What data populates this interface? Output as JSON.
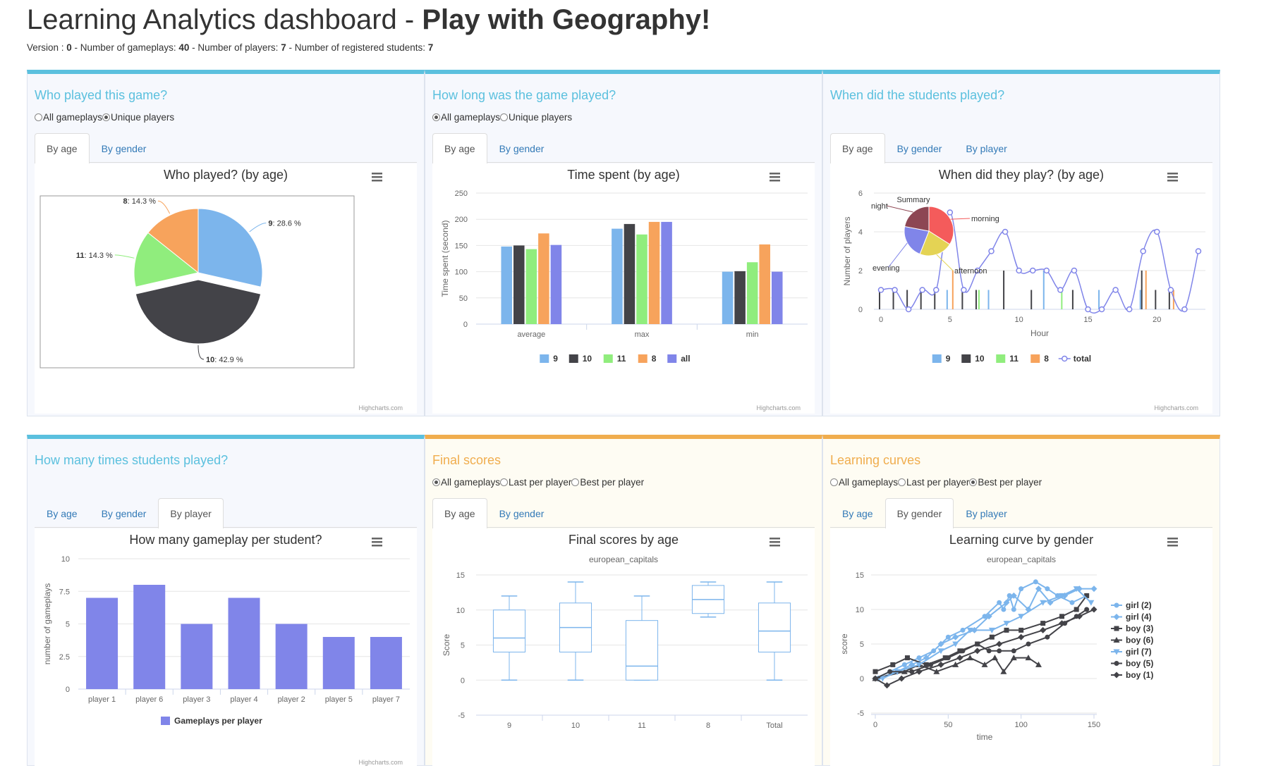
{
  "header": {
    "title": "Learning Analytics dashboard - ",
    "game_name": "Play with Geography!",
    "stats": [
      {
        "label": "Version : ",
        "value": "0"
      },
      {
        "label": " - Number of gameplays: ",
        "value": "40"
      },
      {
        "label": " - Number of players: ",
        "value": "7"
      },
      {
        "label": " - Number of registered students: ",
        "value": "7"
      }
    ]
  },
  "colors": {
    "blue": "#7cb5ec",
    "dark": "#434348",
    "green": "#90ed7d",
    "orange": "#f7a35c",
    "purple": "#8085e9",
    "accent_info": "#5bc0de",
    "accent_warning": "#f0ad4e"
  },
  "panels": {
    "who": {
      "title": "Who played this game?",
      "radios": [
        {
          "label": "All gameplays",
          "checked": false
        },
        {
          "label": "Unique players",
          "checked": true
        }
      ],
      "tabs": [
        {
          "label": "By age",
          "active": true
        },
        {
          "label": "By gender",
          "active": false
        }
      ]
    },
    "time": {
      "title": "How long was the game played?",
      "radios": [
        {
          "label": "All gameplays",
          "checked": true
        },
        {
          "label": "Unique players",
          "checked": false
        }
      ],
      "tabs": [
        {
          "label": "By age",
          "active": true
        },
        {
          "label": "By gender",
          "active": false
        }
      ]
    },
    "when": {
      "title": "When did the students played?",
      "tabs": [
        {
          "label": "By age",
          "active": true
        },
        {
          "label": "By gender",
          "active": false
        },
        {
          "label": "By player",
          "active": false
        }
      ]
    },
    "times": {
      "title": "How many times students played?",
      "tabs": [
        {
          "label": "By age",
          "active": false
        },
        {
          "label": "By gender",
          "active": false
        },
        {
          "label": "By player",
          "active": true
        }
      ]
    },
    "scores": {
      "title": "Final scores",
      "radios": [
        {
          "label": "All gameplays",
          "checked": true
        },
        {
          "label": "Last per player",
          "checked": false
        },
        {
          "label": "Best per player",
          "checked": false
        }
      ],
      "tabs": [
        {
          "label": "By age",
          "active": true
        },
        {
          "label": "By gender",
          "active": false
        }
      ]
    },
    "curves": {
      "title": "Learning curves",
      "radios": [
        {
          "label": "All gameplays",
          "checked": false
        },
        {
          "label": "Last per player",
          "checked": false
        },
        {
          "label": "Best per player",
          "checked": true
        }
      ],
      "tabs": [
        {
          "label": "By age",
          "active": false
        },
        {
          "label": "By gender",
          "active": true
        },
        {
          "label": "By player",
          "active": false
        }
      ]
    }
  },
  "credit": "Highcharts.com",
  "chart_data": [
    {
      "id": "pie",
      "type": "pie",
      "title": "Who played? (by age)",
      "slices": [
        {
          "name": "9",
          "value": 28.6,
          "label": "28.6 %",
          "color": "#7cb5ec"
        },
        {
          "name": "10",
          "value": 42.9,
          "label": "42.9 %",
          "color": "#434348",
          "sliced": true
        },
        {
          "name": "11",
          "value": 14.3,
          "label": "14.3 %",
          "color": "#90ed7d"
        },
        {
          "name": "8",
          "value": 14.3,
          "label": "14.3 %",
          "color": "#f7a35c"
        }
      ]
    },
    {
      "id": "timebar",
      "type": "bar",
      "title": "Time spent (by age)",
      "ylabel": "Time spent (second)",
      "ylim": [
        0,
        250
      ],
      "yticks": [
        0,
        50,
        100,
        150,
        200,
        250
      ],
      "categories": [
        "average",
        "max",
        "min"
      ],
      "series": [
        {
          "name": "9",
          "color": "#7cb5ec",
          "values": [
            148,
            182,
            100
          ]
        },
        {
          "name": "10",
          "color": "#434348",
          "values": [
            150,
            191,
            101
          ]
        },
        {
          "name": "11",
          "color": "#90ed7d",
          "values": [
            143,
            171,
            118
          ]
        },
        {
          "name": "8",
          "color": "#f7a35c",
          "values": [
            173,
            195,
            152
          ]
        },
        {
          "name": "all",
          "color": "#8085e9",
          "values": [
            151,
            195,
            100
          ]
        }
      ]
    },
    {
      "id": "when",
      "type": "line",
      "title": "When did they play? (by age)",
      "xlabel": "Hour",
      "ylabel": "Number of players",
      "ylim": [
        0,
        6
      ],
      "yticks": [
        0,
        2,
        4,
        6
      ],
      "xlim": [
        0,
        23
      ],
      "xticks": [
        0,
        5,
        10,
        15,
        20
      ],
      "bars": [
        {
          "name": "9",
          "color": "#7cb5ec",
          "points": [
            [
              5,
              1
            ],
            [
              8,
              1
            ],
            [
              12,
              2
            ],
            [
              16,
              1
            ],
            [
              19,
              1
            ]
          ]
        },
        {
          "name": "10",
          "color": "#434348",
          "points": [
            [
              0,
              1
            ],
            [
              1,
              1
            ],
            [
              2,
              1
            ],
            [
              3,
              1
            ],
            [
              4,
              1
            ],
            [
              6,
              1
            ],
            [
              7,
              1
            ],
            [
              9,
              2
            ],
            [
              11,
              1
            ],
            [
              14,
              1
            ],
            [
              19,
              2
            ],
            [
              20,
              1
            ],
            [
              21,
              1
            ]
          ]
        },
        {
          "name": "11",
          "color": "#90ed7d",
          "points": [
            [
              7,
              1
            ],
            [
              13,
              1
            ]
          ]
        },
        {
          "name": "8",
          "color": "#f7a35c",
          "points": [
            [
              5,
              2
            ],
            [
              19,
              2
            ],
            [
              21,
              1
            ]
          ]
        }
      ],
      "total": {
        "name": "total",
        "color": "#8085e9",
        "values": [
          1,
          1,
          0,
          1,
          1,
          5,
          1,
          2,
          3,
          4,
          2,
          2,
          2,
          1,
          2,
          0,
          0,
          1,
          0,
          3,
          4,
          1,
          0,
          3
        ]
      },
      "summary": {
        "title": "Summary",
        "slices": [
          {
            "name": "morning",
            "value": 34,
            "color": "#f45b5b"
          },
          {
            "name": "afternoon",
            "value": 22,
            "color": "#e4d354"
          },
          {
            "name": "evening",
            "value": 22,
            "color": "#8085e9"
          },
          {
            "name": "night",
            "value": 22,
            "color": "#8d4653"
          }
        ]
      }
    },
    {
      "id": "gameplays",
      "type": "bar",
      "title": "How many gameplay per student?",
      "ylabel": "number of gameplays",
      "ylim": [
        0,
        10
      ],
      "yticks": [
        0,
        2.5,
        5,
        7.5,
        10
      ],
      "categories": [
        "player 1",
        "player 6",
        "player 3",
        "player 4",
        "player 2",
        "player 5",
        "player 7"
      ],
      "series": [
        {
          "name": "Gameplays per player",
          "color": "#8085e9",
          "values": [
            7,
            8,
            5,
            7,
            5,
            4,
            4
          ]
        }
      ]
    },
    {
      "id": "boxplot",
      "type": "boxplot",
      "title": "Final scores by age",
      "subtitle": "european_capitals",
      "ylabel": "Score",
      "ylim": [
        -5,
        15
      ],
      "yticks": [
        -5,
        0,
        5,
        10,
        15
      ],
      "categories": [
        "9",
        "10",
        "11",
        "8",
        "Total"
      ],
      "boxes": [
        {
          "low": 0,
          "q1": 4,
          "median": 6,
          "q3": 10,
          "high": 12
        },
        {
          "low": 0,
          "q1": 4,
          "median": 7.5,
          "q3": 11,
          "high": 14
        },
        {
          "low": 0,
          "q1": 0,
          "median": 2,
          "q3": 8.5,
          "high": 12
        },
        {
          "low": 9,
          "q1": 9.5,
          "median": 11.5,
          "q3": 13.5,
          "high": 14
        },
        {
          "low": 0,
          "q1": 4,
          "median": 7,
          "q3": 11,
          "high": 14
        }
      ]
    },
    {
      "id": "curves",
      "type": "line",
      "title": "Learning curve by gender",
      "subtitle": "european_capitals",
      "xlabel": "time",
      "ylabel": "score",
      "xlim": [
        0,
        150
      ],
      "xticks": [
        0,
        50,
        100,
        150
      ],
      "ylim": [
        -5,
        15
      ],
      "yticks": [
        -5,
        0,
        5,
        10,
        15
      ],
      "series": [
        {
          "name": "girl (2)",
          "color": "#7cb5ec",
          "marker": "circle",
          "points": [
            [
              0,
              0
            ],
            [
              10,
              1
            ],
            [
              20,
              2
            ],
            [
              30,
              3
            ],
            [
              40,
              4
            ],
            [
              50,
              6
            ],
            [
              60,
              7
            ],
            [
              75,
              9
            ],
            [
              85,
              11
            ],
            [
              88,
              10
            ],
            [
              92,
              12
            ],
            [
              95,
              10
            ],
            [
              100,
              13
            ],
            [
              110,
              14
            ],
            [
              118,
              13
            ],
            [
              125,
              12
            ],
            [
              135,
              11
            ],
            [
              145,
              12
            ]
          ]
        },
        {
          "name": "girl (4)",
          "color": "#7cb5ec",
          "marker": "diamond",
          "points": [
            [
              2,
              0
            ],
            [
              15,
              1
            ],
            [
              25,
              2
            ],
            [
              35,
              3
            ],
            [
              45,
              5
            ],
            [
              55,
              6
            ],
            [
              68,
              7
            ],
            [
              78,
              9
            ],
            [
              90,
              11
            ],
            [
              95,
              12
            ],
            [
              105,
              10
            ],
            [
              112,
              13
            ],
            [
              120,
              11
            ],
            [
              130,
              12
            ],
            [
              140,
              13
            ],
            [
              150,
              13
            ]
          ]
        },
        {
          "name": "boy (3)",
          "color": "#434348",
          "marker": "square",
          "points": [
            [
              0,
              1
            ],
            [
              12,
              2
            ],
            [
              22,
              3
            ],
            [
              35,
              2
            ],
            [
              48,
              3
            ],
            [
              58,
              4
            ],
            [
              70,
              5
            ],
            [
              80,
              6
            ],
            [
              90,
              7
            ],
            [
              100,
              7
            ],
            [
              115,
              8
            ],
            [
              128,
              9
            ],
            [
              138,
              10
            ],
            [
              145,
              12
            ]
          ]
        },
        {
          "name": "boy (6)",
          "color": "#434348",
          "marker": "triangle",
          "points": [
            [
              0,
              0
            ],
            [
              20,
              1
            ],
            [
              30,
              2
            ],
            [
              42,
              1
            ],
            [
              55,
              2
            ],
            [
              65,
              3
            ],
            [
              75,
              2
            ],
            [
              82,
              3
            ],
            [
              88,
              1
            ],
            [
              95,
              3
            ],
            [
              105,
              3
            ],
            [
              112,
              2
            ]
          ]
        },
        {
          "name": "girl (7)",
          "color": "#7cb5ec",
          "marker": "triangle-down",
          "points": [
            [
              5,
              0
            ],
            [
              15,
              1
            ],
            [
              30,
              2
            ],
            [
              45,
              4
            ],
            [
              55,
              5
            ],
            [
              65,
              7
            ],
            [
              80,
              7
            ],
            [
              90,
              8
            ],
            [
              100,
              9
            ],
            [
              115,
              11
            ],
            [
              128,
              12
            ],
            [
              138,
              13
            ],
            [
              148,
              11
            ]
          ]
        },
        {
          "name": "boy (5)",
          "color": "#434348",
          "marker": "circle",
          "points": [
            [
              0,
              0
            ],
            [
              10,
              1
            ],
            [
              25,
              1
            ],
            [
              38,
              2
            ],
            [
              50,
              3
            ],
            [
              60,
              4
            ],
            [
              70,
              5
            ],
            [
              78,
              4
            ],
            [
              85,
              4
            ],
            [
              95,
              4
            ],
            [
              105,
              5
            ],
            [
              118,
              6
            ],
            [
              130,
              8
            ],
            [
              138,
              9
            ],
            [
              145,
              10
            ]
          ]
        },
        {
          "name": "boy (1)",
          "color": "#434348",
          "marker": "diamond",
          "points": [
            [
              0,
              0
            ],
            [
              8,
              -1
            ],
            [
              18,
              0
            ],
            [
              30,
              1
            ],
            [
              45,
              2
            ],
            [
              58,
              3
            ],
            [
              70,
              4
            ],
            [
              85,
              5
            ],
            [
              100,
              6
            ],
            [
              115,
              7
            ],
            [
              128,
              8
            ],
            [
              140,
              9
            ],
            [
              150,
              10
            ]
          ]
        }
      ]
    }
  ]
}
